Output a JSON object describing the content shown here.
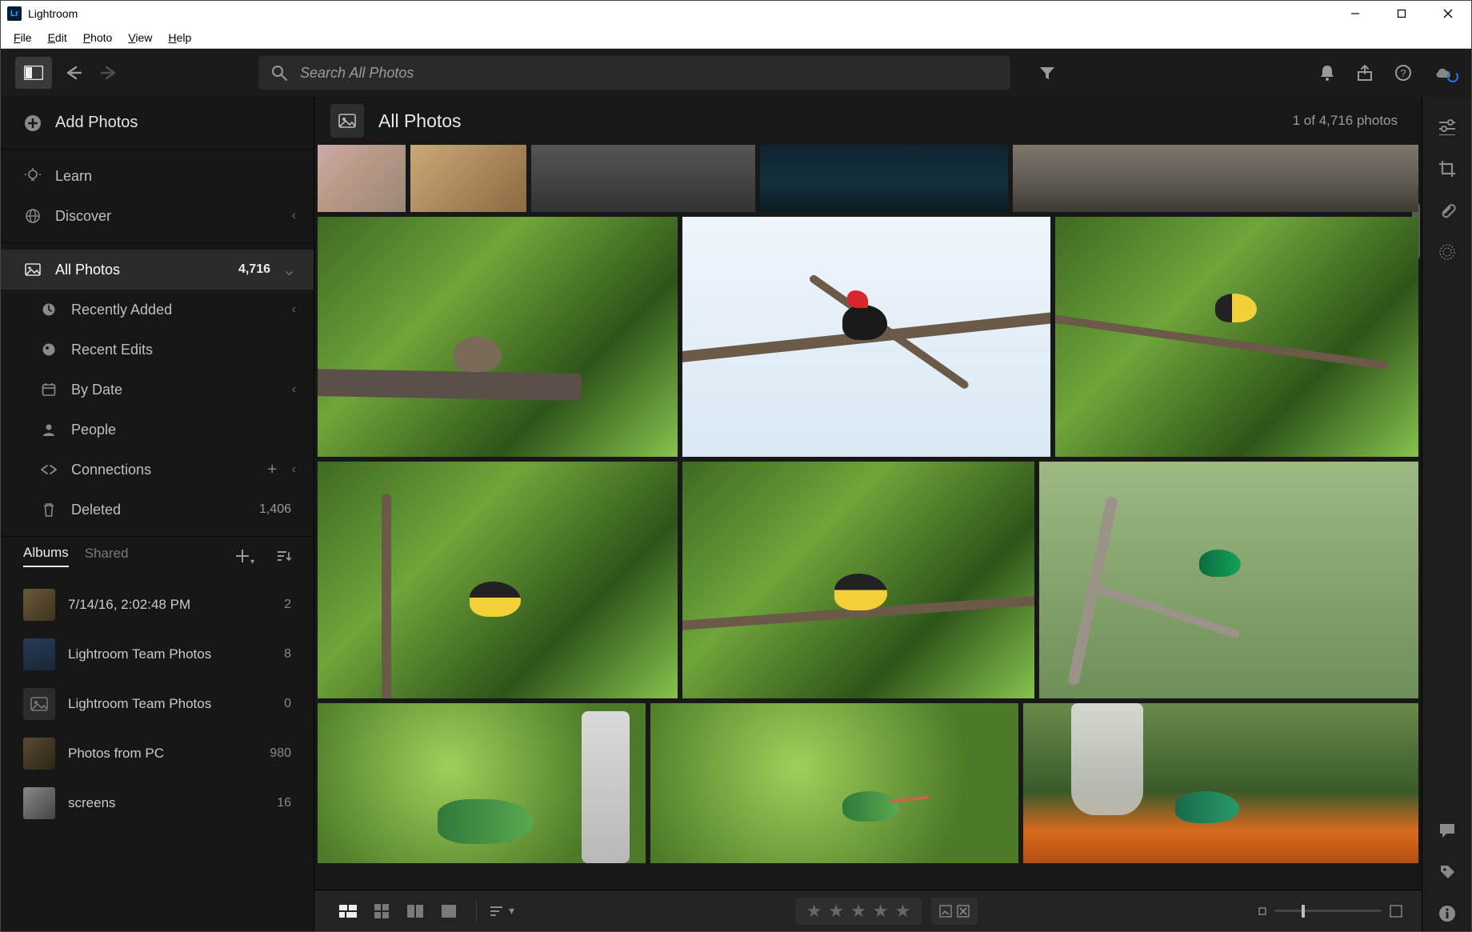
{
  "window": {
    "title": "Lightroom"
  },
  "menu": {
    "file": "File",
    "edit": "Edit",
    "photo": "Photo",
    "view": "View",
    "help": "Help"
  },
  "toolbar": {
    "search_placeholder": "Search All Photos"
  },
  "sidebar": {
    "add_photos": "Add Photos",
    "learn": "Learn",
    "discover": "Discover",
    "all_photos": {
      "label": "All Photos",
      "count": "4,716"
    },
    "recently_added": "Recently Added",
    "recent_edits": "Recent Edits",
    "by_date": "By Date",
    "people": "People",
    "connections": "Connections",
    "deleted": {
      "label": "Deleted",
      "count": "1,406"
    }
  },
  "albums_header": {
    "albums": "Albums",
    "shared": "Shared"
  },
  "albums": [
    {
      "name": "7/14/16, 2:02:48 PM",
      "count": "2"
    },
    {
      "name": "Lightroom Team Photos",
      "count": "8"
    },
    {
      "name": "Lightroom Team Photos",
      "count": "0"
    },
    {
      "name": "Photos from PC",
      "count": "980"
    },
    {
      "name": "screens",
      "count": "16"
    }
  ],
  "content": {
    "title": "All Photos",
    "count_label": "1 of 4,716 photos"
  }
}
